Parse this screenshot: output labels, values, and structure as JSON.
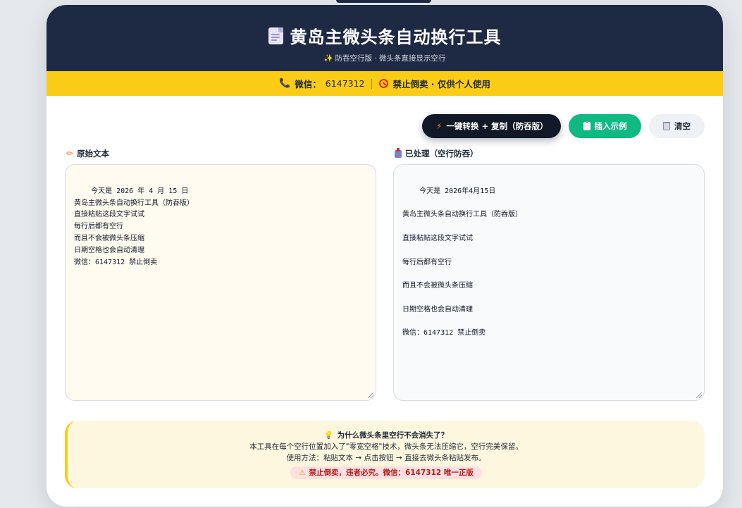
{
  "header": {
    "title": "黄岛主微头条自动换行工具",
    "subtitle": "防吞空行版 · 微头条直接显示空行",
    "sparkle": "✨"
  },
  "notice": {
    "wechat_label": "微信：",
    "wechat_value": "6147312",
    "ban_text": "禁止倒卖 · 仅供个人使用"
  },
  "toolbar": {
    "convert_label": "一键转换 + 复制（防吞版）",
    "example_label": "插入示例",
    "clear_label": "清空"
  },
  "source": {
    "label": "原始文本",
    "text": "今天是 2026 年 4 月 15 日\n黄岛主微头条自动换行工具（防吞版）\n直接粘贴这段文字试试\n每行后都有空行\n而且不会被微头条压缩\n日期空格也会自动清理\n微信：6147312 禁止倒卖"
  },
  "output": {
    "label": "已处理（空行防吞）",
    "text": "今天是 2026年4月15日\n\n黄岛主微头条自动换行工具（防吞版）\n\n直接粘贴这段文字试试\n\n每行后都有空行\n\n而且不会被微头条压缩\n\n日期空格也会自动清理\n\n微信：6147312 禁止倒卖"
  },
  "info": {
    "title": "为什么微头条里空行不会消失了？",
    "line1": "本工具在每个空行位置加入了\"零宽空格\"技术，微头条无法压缩它，空行完美保留。",
    "line2": "使用方法：粘贴文本 → 点击按钮 → 直接去微头条粘贴发布。",
    "warning": "禁止倒卖，违者必究。微信：6147312 唯一正版"
  },
  "icons": {
    "header": "document-icon",
    "phone": "phone-icon",
    "ban": "ban-icon",
    "bolt": "bolt-icon",
    "clipboard": "clipboard-icon",
    "trash": "trash-icon",
    "pencil": "pencil-icon",
    "inbox": "inbox-icon",
    "bulb": "lightbulb-icon",
    "warning": "warning-icon"
  },
  "colors": {
    "header_bg": "#1e2a44",
    "notice_bg": "#facc15",
    "primary_btn": "#111827",
    "green_btn": "#10b981",
    "warning_text": "#b91c1c"
  }
}
